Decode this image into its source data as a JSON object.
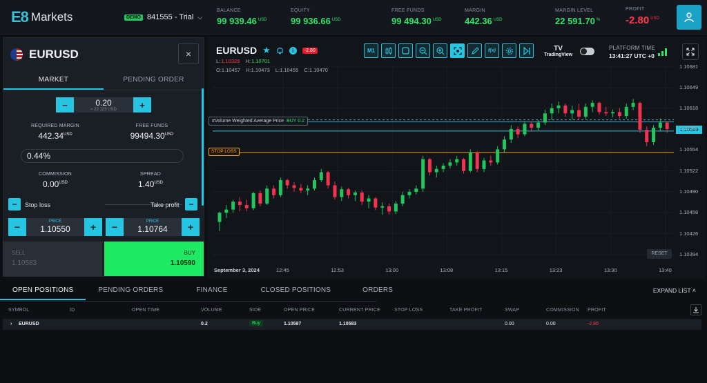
{
  "header": {
    "logo_mark": "E8",
    "logo_text": "Markets",
    "demo_badge": "DEMO",
    "account": "841555 - Trial",
    "balance_label": "BALANCE",
    "balance": "99 939.46",
    "balance_ccy": "USD",
    "equity_label": "EQUITY",
    "equity": "99 936.66",
    "equity_ccy": "USD",
    "free_funds_label": "FREE FUNDS",
    "free_funds": "99 494.30",
    "free_funds_ccy": "USD",
    "margin_label": "MARGIN",
    "margin": "442.36",
    "margin_ccy": "USD",
    "margin_level_label": "MARGIN LEVEL",
    "margin_level": "22 591.70",
    "margin_level_unit": "%",
    "profit_label": "PROFIT",
    "profit": "-2.80",
    "profit_ccy": "USD"
  },
  "ticket": {
    "symbol": "EURUSD",
    "close": "×",
    "tab_market": "MARKET",
    "tab_pending": "PENDING ORDER",
    "volume": "0.20",
    "volume_sub": "≈ 22 123 USD",
    "req_margin_label": "REQUIRED MARGIN",
    "req_margin": "442.34",
    "req_margin_ccy": "USD",
    "free_funds_label": "FREE FUNDS",
    "free_funds": "99494.30",
    "free_funds_ccy": "USD",
    "percent": "0.44%",
    "commission_label": "COMMISSION",
    "commission": "0.00",
    "commission_ccy": "USD",
    "spread_label": "SPREAD",
    "spread": "1.40",
    "spread_ccy": "USD",
    "stop_loss_label": "Stop loss",
    "take_profit_label": "Take profit",
    "price_label": "PRICE",
    "sl_price": "1.10550",
    "tp_price": "1.10764",
    "sell_label": "SELL",
    "sell_price": "1.10583",
    "buy_label": "BUY",
    "buy_price": "1.10590"
  },
  "chart_header": {
    "symbol": "EURUSD",
    "pnl_tag": "-2.80",
    "low_label": "L:",
    "low": "1.10329",
    "high_label": "H:",
    "high": "1.10701",
    "o_label": "O:",
    "o": "1.10457",
    "h_label": "H:",
    "h": "1.10473",
    "l_label": "L:",
    "l": "1.10455",
    "c_label": "C:",
    "c": "1.10470",
    "tool_timeframe": "M1",
    "tool_fx": "f(x)",
    "tv_logo": "TV",
    "tv_text": "TradingView",
    "platform_time_label": "PLATFORM TIME",
    "platform_time": "13:41:27 UTC +0",
    "reset": "RESET",
    "vwap_label": "#Volume Weighted Average Price",
    "vwap_side": "BUY 0.2",
    "stop_loss_tag": "STOP LOSS",
    "current_price": "1.10583"
  },
  "chart_data": {
    "type": "candlestick",
    "price_ticks": [
      "1.10681",
      "1.10649",
      "1.10618",
      "1.10587",
      "1.10554",
      "1.10522",
      "1.10490",
      "1.10458",
      "1.10426",
      "1.10394"
    ],
    "date": "September 3, 2024",
    "time_ticks": [
      "12:45",
      "12:53",
      "13:00",
      "13:08",
      "13:15",
      "13:23",
      "13:30",
      "13:40"
    ],
    "stop_loss": 1.1055,
    "vwap_price": 1.10597,
    "current_price": 1.10583,
    "ylim": [
      1.10394,
      1.10681
    ],
    "candles": [
      [
        1.10444,
        1.1046,
        1.1043,
        1.10458
      ],
      [
        1.10458,
        1.1047,
        1.1045,
        1.10463
      ],
      [
        1.10463,
        1.10478,
        1.10458,
        1.10475
      ],
      [
        1.10475,
        1.10482,
        1.1046,
        1.1047
      ],
      [
        1.1047,
        1.10478,
        1.1046,
        1.10465
      ],
      [
        1.10465,
        1.1049,
        1.10462,
        1.10488
      ],
      [
        1.10488,
        1.10492,
        1.10468,
        1.10472
      ],
      [
        1.10472,
        1.105,
        1.1047,
        1.10495
      ],
      [
        1.10495,
        1.105,
        1.1048,
        1.10485
      ],
      [
        1.10485,
        1.10512,
        1.10482,
        1.10508
      ],
      [
        1.10508,
        1.1051,
        1.10495,
        1.105
      ],
      [
        1.105,
        1.10505,
        1.1049,
        1.10496
      ],
      [
        1.10496,
        1.10502,
        1.10488,
        1.10492
      ],
      [
        1.10492,
        1.105,
        1.10485,
        1.10495
      ],
      [
        1.10495,
        1.10512,
        1.10492,
        1.10508
      ],
      [
        1.10508,
        1.10525,
        1.10505,
        1.1052
      ],
      [
        1.1052,
        1.10522,
        1.10495,
        1.105
      ],
      [
        1.105,
        1.10506,
        1.10478,
        1.10482
      ],
      [
        1.10482,
        1.10498,
        1.10476,
        1.10494
      ],
      [
        1.10494,
        1.10496,
        1.1048,
        1.10485
      ],
      [
        1.10485,
        1.10492,
        1.10476,
        1.10489
      ],
      [
        1.10489,
        1.10492,
        1.1047,
        1.10475
      ],
      [
        1.10475,
        1.10485,
        1.10465,
        1.1048
      ],
      [
        1.1048,
        1.10482,
        1.10462,
        1.10466
      ],
      [
        1.10466,
        1.10474,
        1.10455,
        1.10468
      ],
      [
        1.10468,
        1.10472,
        1.10455,
        1.1046
      ],
      [
        1.1046,
        1.10476,
        1.10456,
        1.10472
      ],
      [
        1.10472,
        1.1049,
        1.10468,
        1.10485
      ],
      [
        1.10485,
        1.10494,
        1.1048,
        1.1049
      ],
      [
        1.1049,
        1.105,
        1.10486,
        1.10495
      ],
      [
        1.10495,
        1.10545,
        1.1049,
        1.1054
      ],
      [
        1.1054,
        1.10542,
        1.10515,
        1.1052
      ],
      [
        1.1052,
        1.1053,
        1.10512,
        1.10525
      ],
      [
        1.10525,
        1.10534,
        1.1052,
        1.1053
      ],
      [
        1.1053,
        1.1054,
        1.10526,
        1.10535
      ],
      [
        1.10535,
        1.10545,
        1.1053,
        1.1054
      ],
      [
        1.1054,
        1.10542,
        1.10518,
        1.10522
      ],
      [
        1.10522,
        1.10555,
        1.1052,
        1.1055
      ],
      [
        1.1055,
        1.10552,
        1.1052,
        1.10525
      ],
      [
        1.10525,
        1.10542,
        1.1052,
        1.10538
      ],
      [
        1.10538,
        1.10545,
        1.1053,
        1.10535
      ],
      [
        1.10535,
        1.1056,
        1.10532,
        1.10555
      ],
      [
        1.10555,
        1.10575,
        1.1055,
        1.1057
      ],
      [
        1.1057,
        1.10592,
        1.10565,
        1.10586
      ],
      [
        1.10586,
        1.1059,
        1.10572,
        1.10578
      ],
      [
        1.10578,
        1.10598,
        1.10575,
        1.10594
      ],
      [
        1.10594,
        1.10598,
        1.10582,
        1.10588
      ],
      [
        1.10588,
        1.106,
        1.10584,
        1.10596
      ],
      [
        1.10596,
        1.10616,
        1.10592,
        1.1061
      ],
      [
        1.1061,
        1.10625,
        1.106,
        1.10618
      ],
      [
        1.10618,
        1.10628,
        1.1061,
        1.10622
      ],
      [
        1.10622,
        1.10625,
        1.10605,
        1.1061
      ],
      [
        1.1061,
        1.10622,
        1.106,
        1.10615
      ],
      [
        1.10615,
        1.10625,
        1.106,
        1.10605
      ],
      [
        1.10605,
        1.10625,
        1.10602,
        1.1062
      ],
      [
        1.1062,
        1.1063,
        1.10612,
        1.10626
      ],
      [
        1.10626,
        1.10628,
        1.10608,
        1.10612
      ],
      [
        1.10612,
        1.1062,
        1.10606,
        1.1061
      ],
      [
        1.1061,
        1.10616,
        1.10604,
        1.10612
      ],
      [
        1.10612,
        1.10618,
        1.10602,
        1.10606
      ],
      [
        1.10606,
        1.10625,
        1.10602,
        1.1062
      ],
      [
        1.1062,
        1.10632,
        1.10615,
        1.10626
      ],
      [
        1.10626,
        1.10628,
        1.1058,
        1.10585
      ],
      [
        1.10585,
        1.1059,
        1.1056,
        1.10566
      ],
      [
        1.10566,
        1.10592,
        1.10562,
        1.10588
      ],
      [
        1.10588,
        1.10602,
        1.10582,
        1.10596
      ],
      [
        1.10596,
        1.10598,
        1.1058,
        1.10586
      ]
    ]
  },
  "bottom": {
    "tabs": [
      "OPEN POSITIONS",
      "PENDING ORDERS",
      "FINANCE",
      "CLOSED POSITIONS",
      "ORDERS"
    ],
    "expand": "EXPAND LIST",
    "columns": [
      "SYMBOL",
      "ID",
      "OPEN TIME",
      "VOLUME",
      "SIDE",
      "OPEN PRICE",
      "CURRENT PRICE",
      "STOP LOSS",
      "TAKE PROFIT",
      "SWAP",
      "COMMISSION",
      "PROFIT"
    ],
    "row": {
      "symbol": "EURUSD",
      "volume": "0.2",
      "side": "Buy",
      "open_price": "1.10597",
      "current_price": "1.10583",
      "swap": "0.00",
      "commission": "0.00",
      "profit": "-2.80"
    }
  }
}
